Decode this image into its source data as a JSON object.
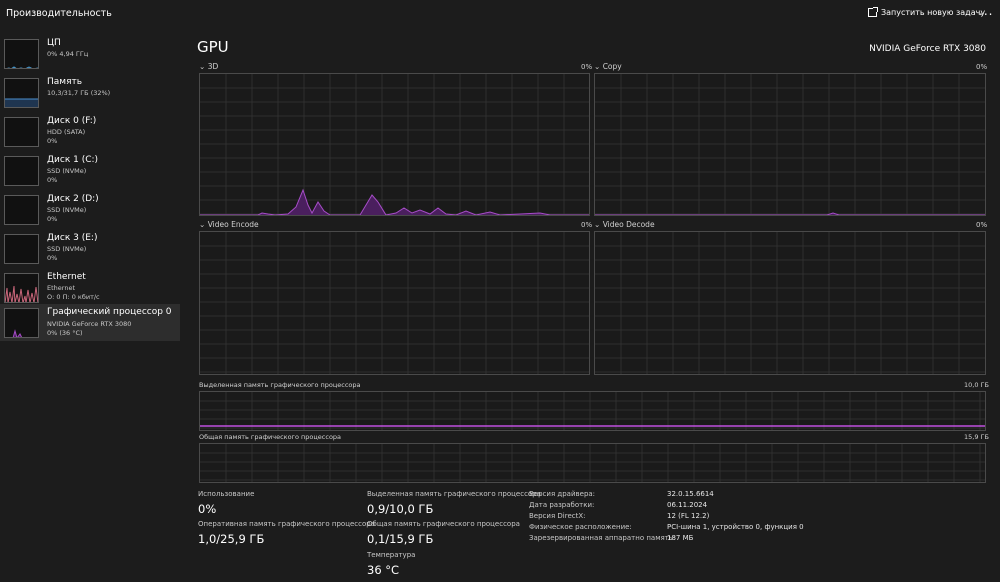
{
  "app": {
    "title": "Производительность",
    "run_new_task": "Запустить новую задачу",
    "more": "..."
  },
  "sidebar": {
    "items": [
      {
        "name": "ЦП",
        "sub": "0% 4,94 ГГц",
        "val": ""
      },
      {
        "name": "Память",
        "sub": "10,3/31,7 ГБ (32%)",
        "val": ""
      },
      {
        "name": "Диск 0 (F:)",
        "sub": "HDD (SATA)",
        "val": "0%"
      },
      {
        "name": "Диск 1 (C:)",
        "sub": "SSD (NVMe)",
        "val": "0%"
      },
      {
        "name": "Диск 2 (D:)",
        "sub": "SSD (NVMe)",
        "val": "0%"
      },
      {
        "name": "Диск 3 (E:)",
        "sub": "SSD (NVMe)",
        "val": "0%"
      },
      {
        "name": "Ethernet",
        "sub": "Ethernet",
        "val": "О: 0 П: 0 кбит/с"
      },
      {
        "name": "Графический процессор 0",
        "sub": "NVIDIA GeForce RTX 3080",
        "val": "0% (36 °C)"
      }
    ]
  },
  "gpu": {
    "title": "GPU",
    "model": "NVIDIA GeForce RTX 3080",
    "graphs": {
      "g3d": {
        "label": "3D",
        "pct": "0%"
      },
      "copy": {
        "label": "Copy",
        "pct": "0%"
      },
      "encode": {
        "label": "Video Encode",
        "pct": "0%"
      },
      "decode": {
        "label": "Video Decode",
        "pct": "0%"
      },
      "dedicated": {
        "label": "Выделенная память графического процессора",
        "max": "10,0 ГБ"
      },
      "shared": {
        "label": "Общая память графического процессора",
        "max": "15,9 ГБ"
      }
    }
  },
  "stats": {
    "usage": {
      "label": "Использование",
      "value": "0%"
    },
    "gpu_ram": {
      "label": "Оперативная память графического процессора",
      "value": "1,0/25,9 ГБ"
    },
    "dedicated": {
      "label": "Выделенная память графического процессора",
      "value": "0,9/10,0 ГБ"
    },
    "shared": {
      "label": "Общая память графического процессора",
      "value": "0,1/15,9 ГБ"
    },
    "temp": {
      "label": "Температура",
      "value": "36 °C"
    }
  },
  "info": [
    {
      "label": "Версия драйвера:",
      "value": "32.0.15.6614"
    },
    {
      "label": "Дата разработки:",
      "value": "06.11.2024"
    },
    {
      "label": "Версия DirectX:",
      "value": "12 (FL 12.2)"
    },
    {
      "label": "Физическое расположение:",
      "value": "PCI-шина 1, устройство 0, функция 0"
    },
    {
      "label": "Зарезервированная аппаратно память:",
      "value": "187 МБ"
    }
  ],
  "colors": {
    "accent": "#a64dc7",
    "accent_fill": "#4a1f5e",
    "memory_line": "#c050e0",
    "grid": "#2f2f2f",
    "border": "#4a4a4a"
  },
  "icons": {
    "chevron": "chevron-down-icon",
    "run": "run-task-icon",
    "more": "more-icon"
  }
}
